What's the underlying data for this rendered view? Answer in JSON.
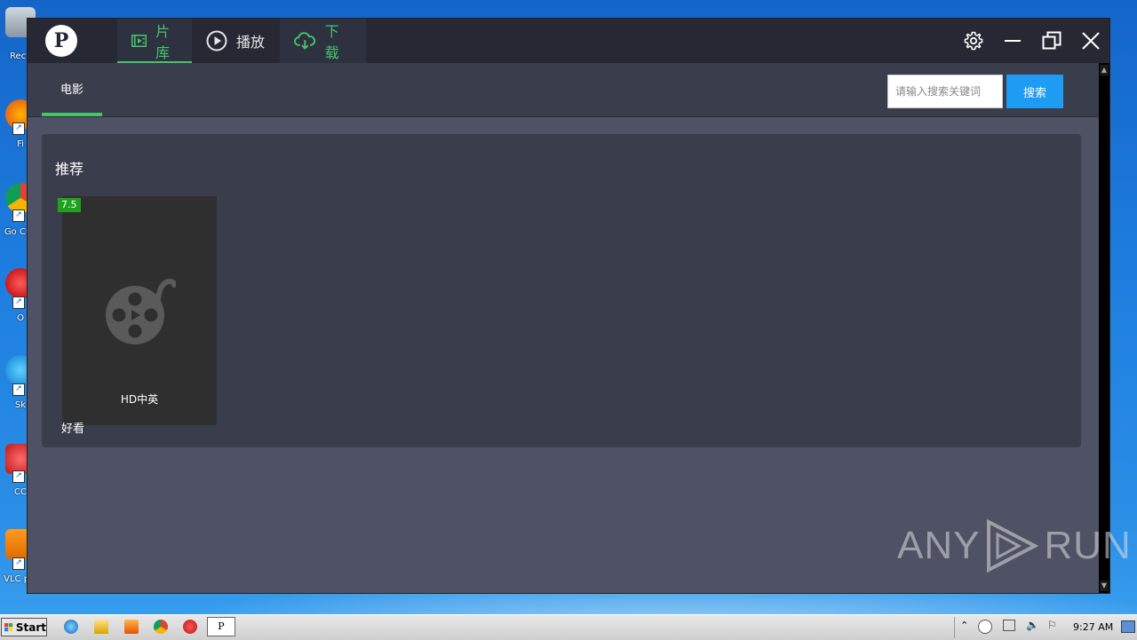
{
  "desktop": {
    "icons": [
      {
        "label": "Recy"
      },
      {
        "label": "Fi"
      },
      {
        "label": "Go Ch"
      },
      {
        "label": "O"
      },
      {
        "label": "Sk"
      },
      {
        "label": "CC"
      },
      {
        "label": "VLC pl"
      }
    ]
  },
  "app": {
    "logo_text": "P",
    "nav": {
      "library_label": "片库",
      "play_label": "播放",
      "download_label": "下载"
    },
    "subtabs": [
      "电影"
    ],
    "search": {
      "placeholder": "请输入搜索关键词",
      "button_label": "搜索"
    },
    "section": {
      "title": "推荐",
      "movies": [
        {
          "title": "好看",
          "rating": "7.5",
          "badge": "HD中英"
        }
      ]
    }
  },
  "watermark": {
    "left": "ANY",
    "right": "RUN"
  },
  "taskbar": {
    "start_label": "Start",
    "active_app_glyph": "P",
    "clock": "9:27 AM"
  },
  "colors": {
    "accent_green": "#45c46a",
    "search_blue": "#1e9bf3",
    "rating_green": "#1ea21e",
    "titlebar": "#262833"
  }
}
